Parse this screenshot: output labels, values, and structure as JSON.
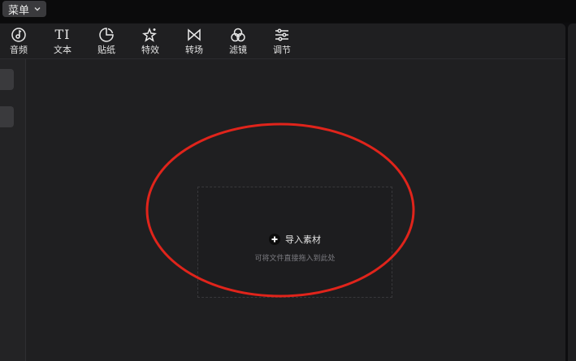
{
  "menu": {
    "label": "菜单",
    "icon": "chevron-down-icon"
  },
  "toolbar": {
    "items": [
      {
        "label": "音频",
        "icon": "audio-icon"
      },
      {
        "label": "文本",
        "icon": "text-icon",
        "glyph": "TI"
      },
      {
        "label": "贴纸",
        "icon": "sticker-icon"
      },
      {
        "label": "特效",
        "icon": "effects-icon"
      },
      {
        "label": "转场",
        "icon": "transition-icon"
      },
      {
        "label": "滤镜",
        "icon": "filter-icon"
      },
      {
        "label": "调节",
        "icon": "adjust-icon"
      }
    ]
  },
  "import": {
    "button_label": "导入素材",
    "hint": "可将文件直接拖入到此处",
    "icon": "plus-icon"
  },
  "colors": {
    "background": "#1f1f21",
    "annotation": "#e0241b"
  }
}
